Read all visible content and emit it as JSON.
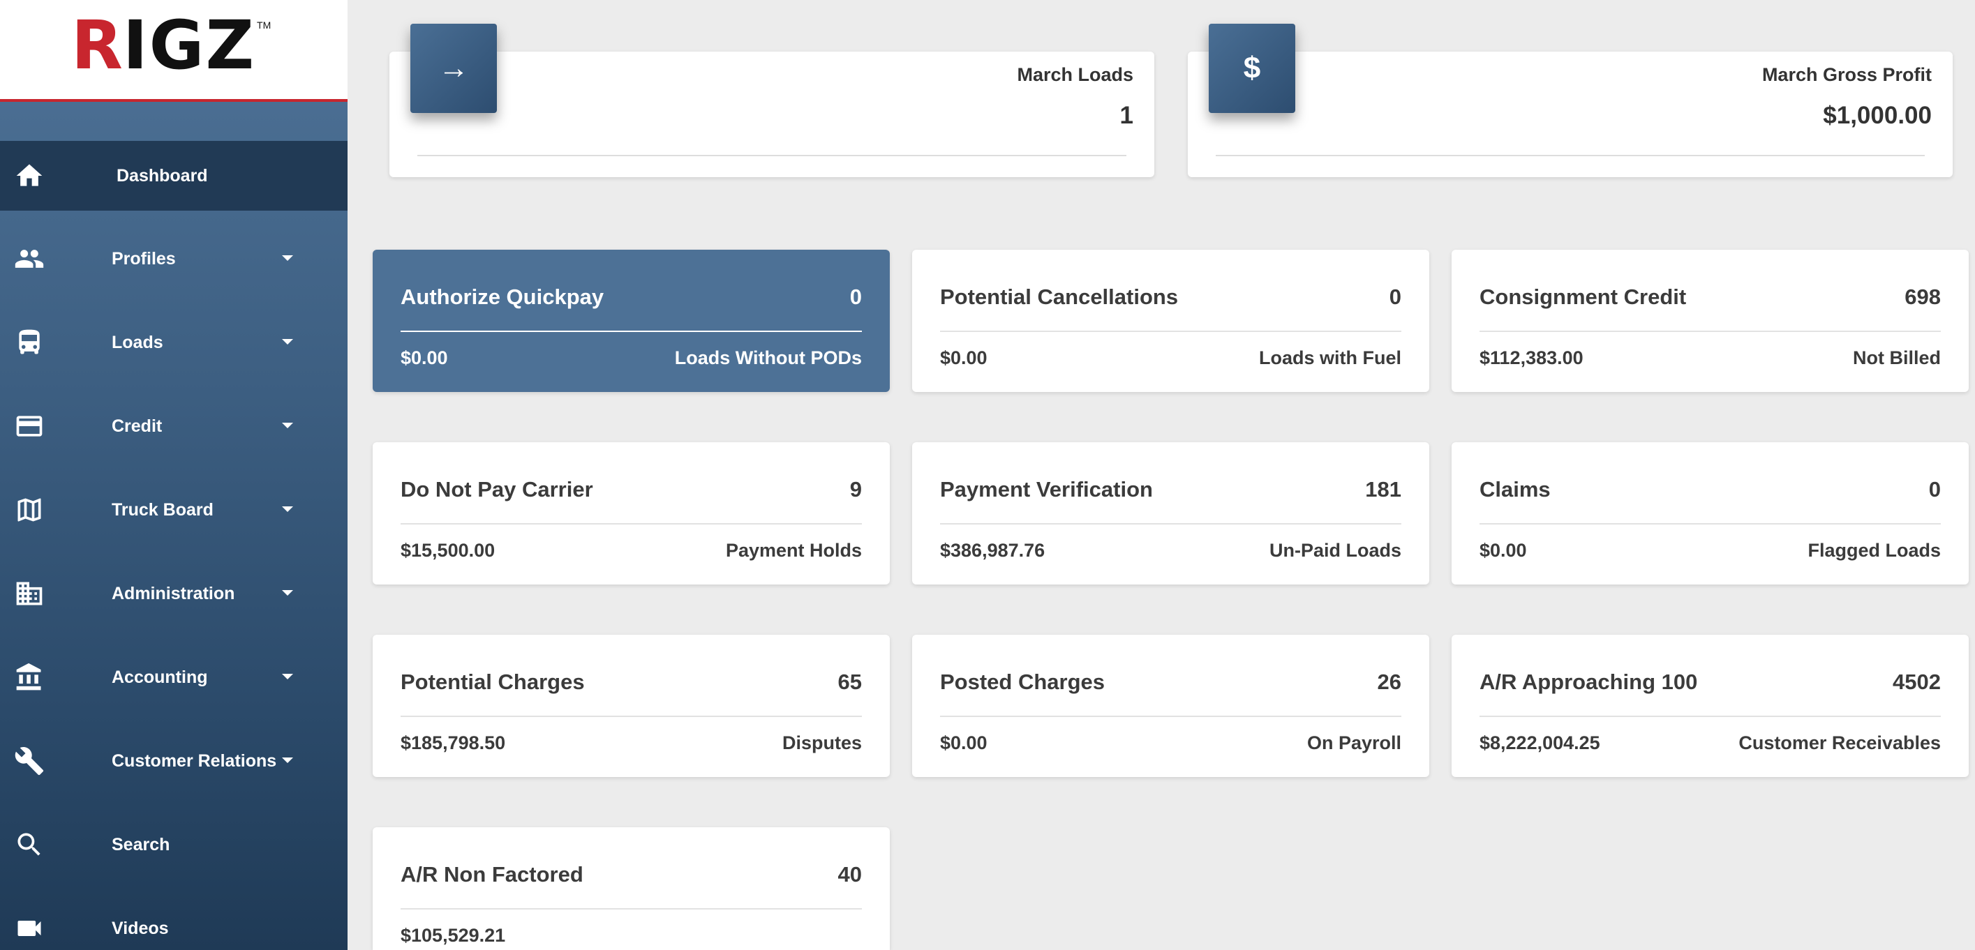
{
  "brand": {
    "logo_r": "R",
    "logo_rest": "IGZ",
    "logo_tm": "TM",
    "accent": "#c8262e",
    "primary": "#4d7196"
  },
  "sidebar": {
    "items": [
      {
        "label": "Dashboard",
        "icon": "home-icon",
        "active": true
      },
      {
        "label": "Profiles",
        "icon": "people-icon",
        "dropdown": true
      },
      {
        "label": "Loads",
        "icon": "bus-icon",
        "dropdown": true
      },
      {
        "label": "Credit",
        "icon": "credit-card-icon",
        "dropdown": true
      },
      {
        "label": "Truck Board",
        "icon": "map-icon",
        "dropdown": true
      },
      {
        "label": "Administration",
        "icon": "building-icon",
        "dropdown": true
      },
      {
        "label": "Accounting",
        "icon": "bank-icon",
        "dropdown": true
      },
      {
        "label": "Customer Relations",
        "icon": "wrench-icon",
        "dropdown": true
      },
      {
        "label": "Search",
        "icon": "search-icon"
      },
      {
        "label": "Videos",
        "icon": "video-camera-icon"
      }
    ]
  },
  "stats": {
    "loads": {
      "icon": "→",
      "icon_name": "arrow-right-icon",
      "title": "March Loads",
      "value": "1"
    },
    "profit": {
      "icon": "$",
      "icon_name": "dollar-icon",
      "title": "March Gross Profit",
      "value": "$1,000.00"
    }
  },
  "cards": [
    {
      "title": "Authorize Quickpay",
      "count": "0",
      "amount": "$0.00",
      "sub": "Loads Without PODs",
      "highlight": true
    },
    {
      "title": "Potential Cancellations",
      "count": "0",
      "amount": "$0.00",
      "sub": "Loads with Fuel"
    },
    {
      "title": "Consignment Credit",
      "count": "698",
      "amount": "$112,383.00",
      "sub": "Not Billed"
    },
    {
      "title": "Do Not Pay Carrier",
      "count": "9",
      "amount": "$15,500.00",
      "sub": "Payment Holds"
    },
    {
      "title": "Payment Verification",
      "count": "181",
      "amount": "$386,987.76",
      "sub": "Un-Paid Loads"
    },
    {
      "title": "Claims",
      "count": "0",
      "amount": "$0.00",
      "sub": "Flagged Loads"
    },
    {
      "title": "Potential Charges",
      "count": "65",
      "amount": "$185,798.50",
      "sub": "Disputes"
    },
    {
      "title": "Posted Charges",
      "count": "26",
      "amount": "$0.00",
      "sub": "On Payroll"
    },
    {
      "title": "A/R Approaching 100",
      "count": "4502",
      "amount": "$8,222,004.25",
      "sub": "Customer Receivables"
    },
    {
      "title": "A/R Non Factored",
      "count": "40",
      "amount": "$105,529.21",
      "sub": ""
    }
  ]
}
